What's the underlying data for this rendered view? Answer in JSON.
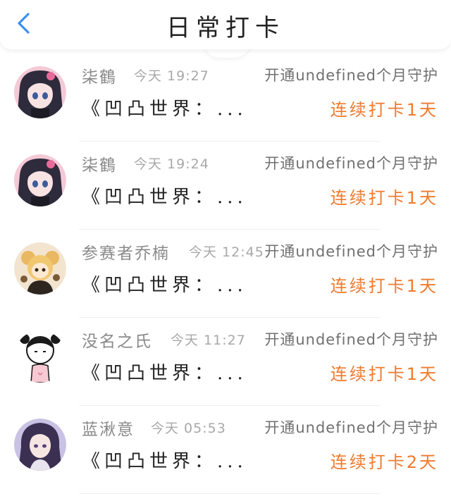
{
  "header": {
    "title": "日常打卡",
    "back_icon": "chevron-left-icon",
    "accent_color": "#3d8ff0"
  },
  "items": [
    {
      "name": "柒鶴",
      "time": "今天 19:27",
      "guard": "开通undefined个月守护",
      "book": "《凹凸世界：...",
      "streak": "连续打卡1天",
      "avatar": "anime-girl-avatar"
    },
    {
      "name": "柒鶴",
      "time": "今天 19:24",
      "guard": "开通undefined个月守护",
      "book": "《凹凸世界：...",
      "streak": "连续打卡1天",
      "avatar": "anime-girl-avatar"
    },
    {
      "name": "参赛者乔楠",
      "time": "今天 12:45",
      "guard": "开通undefined个月守护",
      "book": "《凹凸世界：...",
      "streak": "连续打卡1天",
      "avatar": "chibi-avatar"
    },
    {
      "name": "没名之氏",
      "time": "今天 11:27",
      "guard": "开通undefined个月守护",
      "book": "《凹凸世界：...",
      "streak": "连续打卡1天",
      "avatar": "doodle-girl-avatar"
    },
    {
      "name": "蓝湫意",
      "time": "今天 05:53",
      "guard": "开通undefined个月守护",
      "book": "《凹凸世界：...",
      "streak": "连续打卡2天",
      "avatar": "anime-boy-avatar"
    }
  ]
}
